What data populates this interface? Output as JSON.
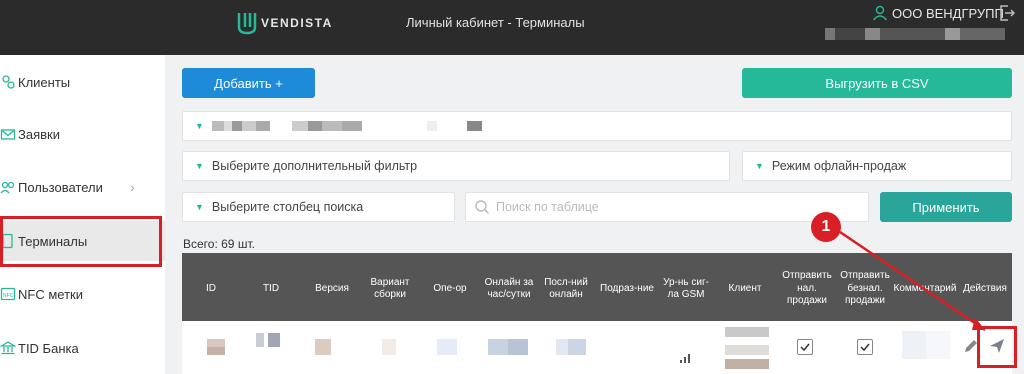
{
  "header": {
    "logo_text": "VENDISTA",
    "title": "Личный кабинет - Терминалы",
    "company": "ООО ВЕНДГРУПП"
  },
  "sidebar": {
    "items": [
      {
        "label": "Клиенты",
        "icon": "users-icon"
      },
      {
        "label": "Заявки",
        "icon": "envelope-icon"
      },
      {
        "label": "Пользователи",
        "icon": "user-group-icon"
      },
      {
        "label": "Терминалы",
        "icon": "terminal-icon"
      },
      {
        "label": "NFC метки",
        "icon": "nfc-icon"
      },
      {
        "label": "TID Банка",
        "icon": "bank-icon"
      }
    ]
  },
  "toolbar": {
    "add_label": "Добавить +",
    "export_label": "Выгрузить в CSV",
    "apply_label": "Применить"
  },
  "filters": {
    "extra_placeholder": "Выберите дополнительный фильтр",
    "offline_mode": "Режим офлайн-продаж",
    "search_column": "Выберите столбец поиска",
    "search_placeholder": "Поиск по таблице"
  },
  "total": "Всего: 69 шт.",
  "table": {
    "columns": [
      "ID",
      "TID",
      "Версия",
      "Вариант сборки",
      "Опе-ор",
      "Онлайн за час/сутки",
      "Посл-ний онлайн",
      "Подраз-ние",
      "Ур-нь сиг-ла GSM",
      "Клиент",
      "Отправить нал. продажи",
      "Отправить безнал. продажи",
      "Комментарий",
      "Действия"
    ]
  },
  "annotation": {
    "badge": "1"
  },
  "colors": {
    "accent_blue": "#1d8bd7",
    "accent_teal": "#25b99a",
    "highlight_red": "#d81f26",
    "header_bg": "#2b2b2b",
    "table_header_bg": "#555555"
  }
}
